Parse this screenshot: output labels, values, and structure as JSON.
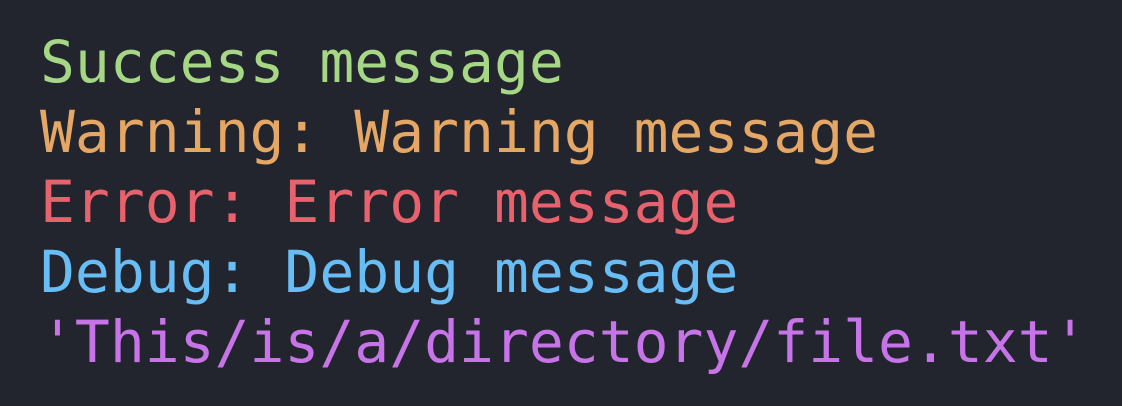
{
  "terminal": {
    "background": "#22252d",
    "lines": [
      {
        "text": "Success message",
        "color": "#a6d784"
      },
      {
        "text": "Warning: Warning message",
        "color": "#e5a765"
      },
      {
        "text": "Error: Error message",
        "color": "#e8626e"
      },
      {
        "text": "Debug: Debug message",
        "color": "#68bdf4"
      },
      {
        "text": "'This/is/a/directory/file.txt'",
        "color": "#c774e8"
      }
    ]
  }
}
